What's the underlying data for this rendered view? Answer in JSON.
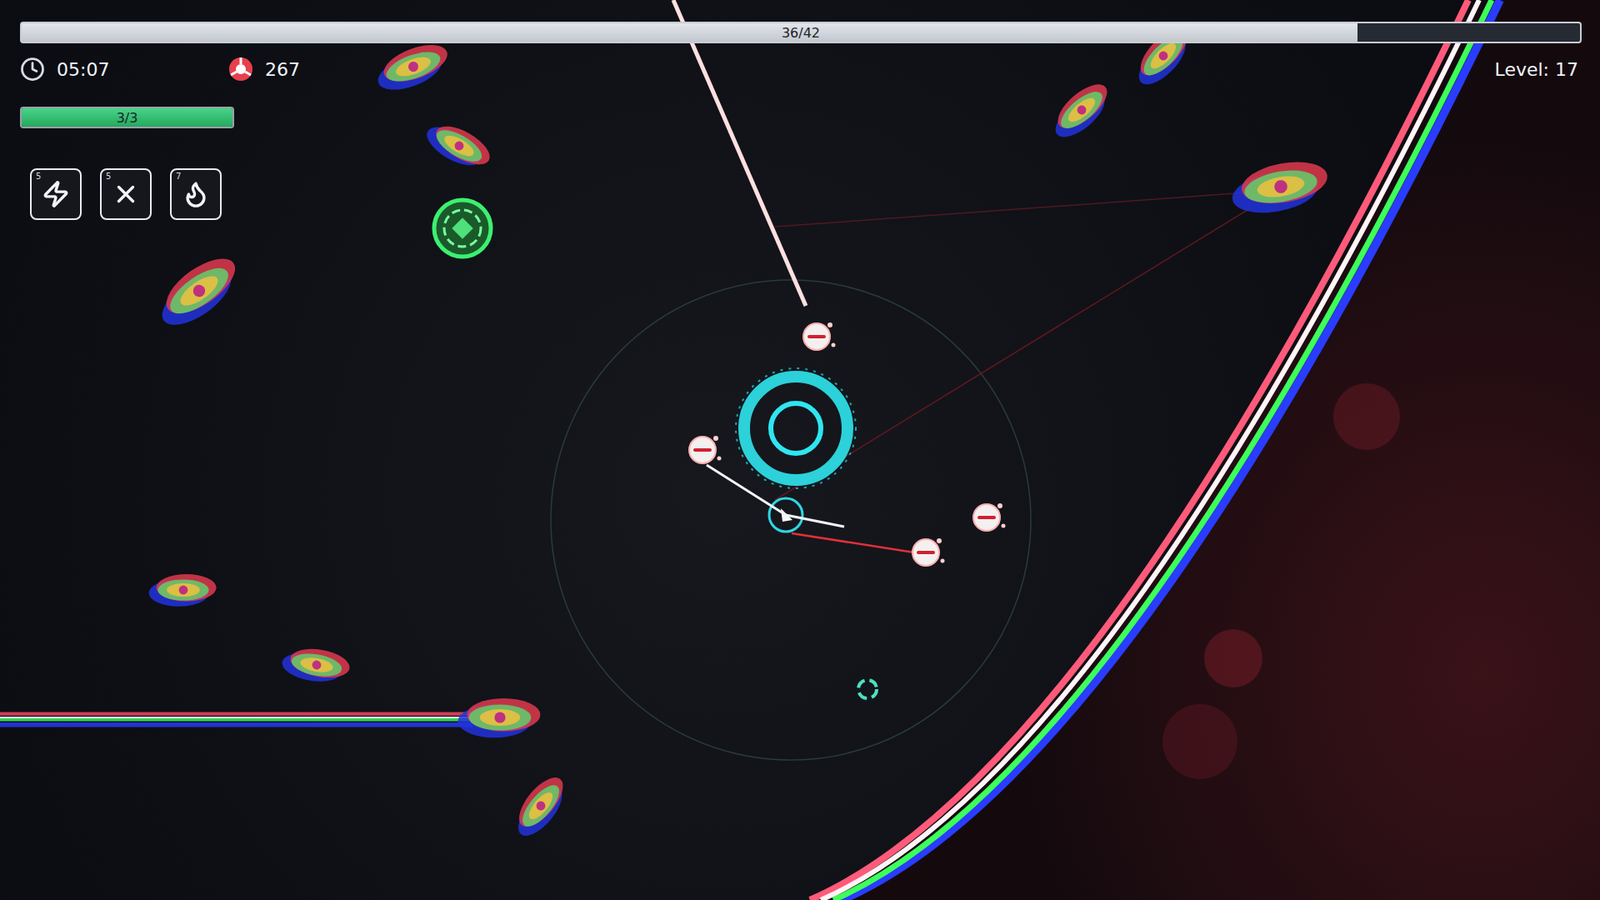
{
  "progress": {
    "text": "36/42",
    "level": 0.857
  },
  "stats": [
    {
      "kind": "timer",
      "value": "05:07"
    },
    {
      "kind": "currency",
      "value": "267"
    }
  ],
  "level": {
    "text": "Level: 17"
  },
  "health": {
    "text": "3/3",
    "level": 1
  },
  "abilities": [
    {
      "key": "5",
      "kind": "lightning"
    },
    {
      "key": "5",
      "kind": "cross"
    },
    {
      "key": "7",
      "kind": "burst"
    }
  ],
  "playfield": {
    "enemies": [
      {
        "kind": "prism"
      },
      {
        "kind": "prism"
      },
      {
        "kind": "prism"
      },
      {
        "kind": "prism"
      },
      {
        "kind": "prism"
      },
      {
        "kind": "prism"
      },
      {
        "kind": "prism"
      },
      {
        "kind": "prism"
      },
      {
        "kind": "prism"
      },
      {
        "kind": "prism"
      },
      {
        "kind": "drone"
      },
      {
        "kind": "drone"
      },
      {
        "kind": "drone"
      },
      {
        "kind": "drone"
      }
    ],
    "pickups": [
      {
        "kind": "shield"
      },
      {
        "kind": "ring"
      }
    ]
  }
}
